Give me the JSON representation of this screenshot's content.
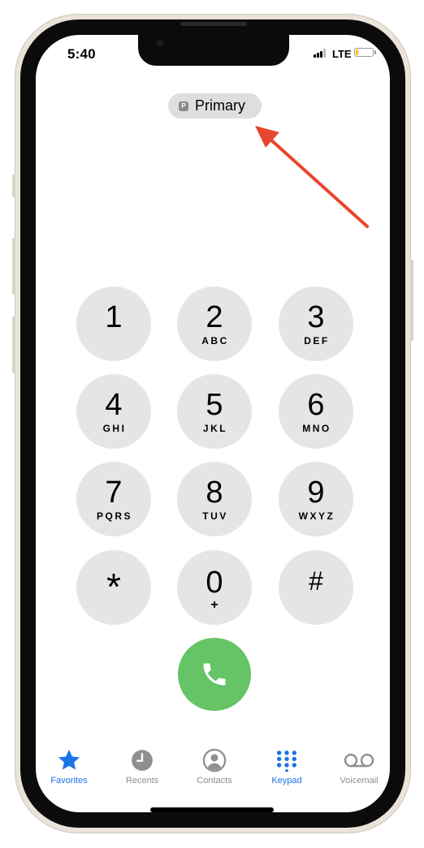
{
  "status_bar": {
    "time": "5:40",
    "network": "LTE",
    "battery_level": 0.15,
    "battery_color": "#f5c400"
  },
  "line_selector": {
    "badge": "P",
    "label": "Primary"
  },
  "annotation": {
    "color": "#e8462f"
  },
  "keypad": {
    "keys": [
      {
        "digit": "1",
        "letters": ""
      },
      {
        "digit": "2",
        "letters": "ABC"
      },
      {
        "digit": "3",
        "letters": "DEF"
      },
      {
        "digit": "4",
        "letters": "GHI"
      },
      {
        "digit": "5",
        "letters": "JKL"
      },
      {
        "digit": "6",
        "letters": "MNO"
      },
      {
        "digit": "7",
        "letters": "PQRS"
      },
      {
        "digit": "8",
        "letters": "TUV"
      },
      {
        "digit": "9",
        "letters": "WXYZ"
      },
      {
        "digit": "*",
        "letters": ""
      },
      {
        "digit": "0",
        "letters": "+"
      },
      {
        "digit": "#",
        "letters": ""
      }
    ],
    "call_button_color": "#65c466",
    "call_icon": "phone-icon"
  },
  "tab_bar": {
    "active_color": "#1a73e8",
    "inactive_color": "#8e8e93",
    "tabs": [
      {
        "label": "Favorites",
        "icon": "star-icon",
        "active": true
      },
      {
        "label": "Recents",
        "icon": "clock-icon",
        "active": false
      },
      {
        "label": "Contacts",
        "icon": "person-circle-icon",
        "active": false
      },
      {
        "label": "Keypad",
        "icon": "keypad-grid-icon",
        "active": true
      },
      {
        "label": "Voicemail",
        "icon": "voicemail-icon",
        "active": false
      }
    ]
  }
}
